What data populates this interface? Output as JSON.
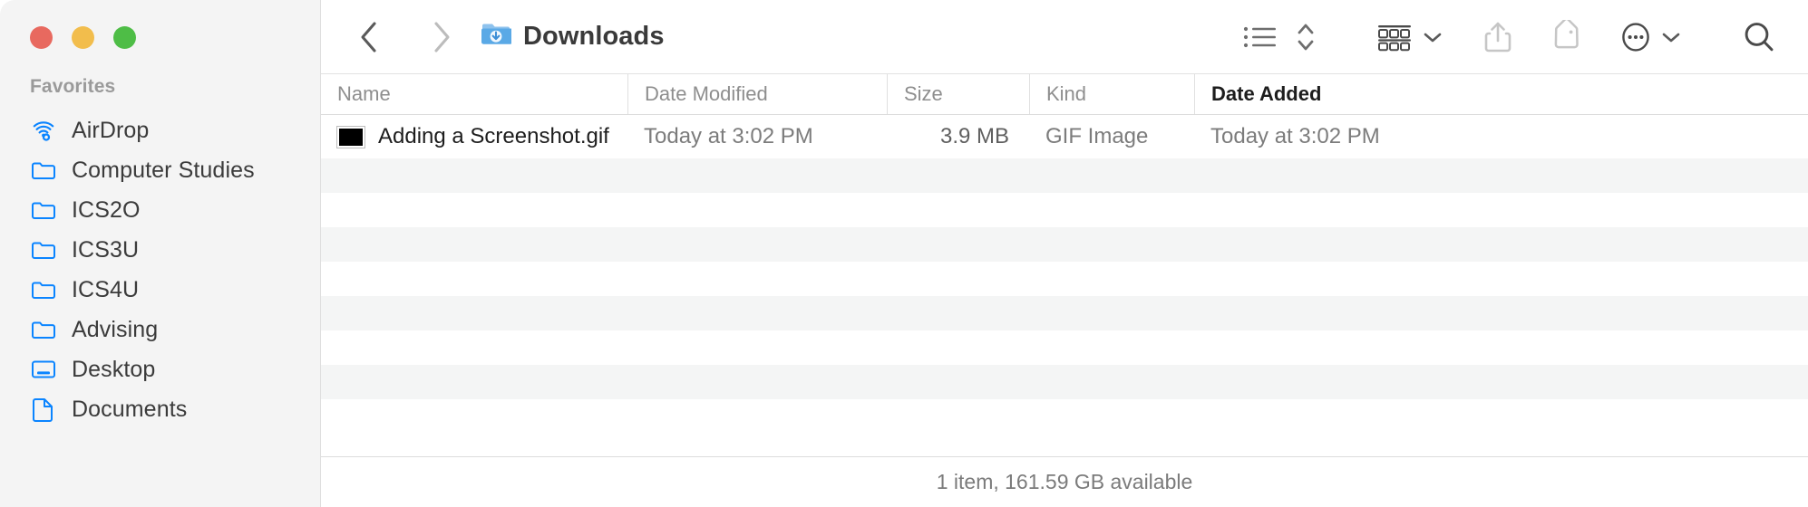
{
  "window": {
    "title": "Downloads",
    "title_icon": "downloads-folder-icon",
    "traffic_lights": [
      {
        "name": "close",
        "color": "#e8695f"
      },
      {
        "name": "minimize",
        "color": "#f2bd4c"
      },
      {
        "name": "zoom",
        "color": "#4ebd46"
      }
    ]
  },
  "sidebar": {
    "section_label": "Favorites",
    "items": [
      {
        "label": "AirDrop",
        "icon": "airdrop-icon"
      },
      {
        "label": "Computer Studies",
        "icon": "folder-icon"
      },
      {
        "label": "ICS2O",
        "icon": "folder-icon"
      },
      {
        "label": "ICS3U",
        "icon": "folder-icon"
      },
      {
        "label": "ICS4U",
        "icon": "folder-icon"
      },
      {
        "label": "Advising",
        "icon": "folder-icon"
      },
      {
        "label": "Desktop",
        "icon": "desktop-icon"
      },
      {
        "label": "Documents",
        "icon": "documents-icon"
      }
    ]
  },
  "toolbar": {
    "back_label": "Back",
    "forward_label": "Forward",
    "view_list_label": "List View",
    "view_stepper_label": "View Options",
    "group_label": "Group Items",
    "share_label": "Share",
    "tag_label": "Tags",
    "more_label": "More Options",
    "search_label": "Search"
  },
  "file_list": {
    "columns": [
      {
        "key": "name",
        "label": "Name",
        "active": false
      },
      {
        "key": "date_modified",
        "label": "Date Modified",
        "active": false
      },
      {
        "key": "size",
        "label": "Size",
        "active": false
      },
      {
        "key": "kind",
        "label": "Kind",
        "active": false
      },
      {
        "key": "date_added",
        "label": "Date Added",
        "active": true
      }
    ],
    "rows": [
      {
        "name": "Adding a Screenshot.gif",
        "date_modified": "Today at 3:02 PM",
        "size": "3.9 MB",
        "kind": "GIF Image",
        "date_added": "Today at 3:02 PM",
        "icon": "gif-thumbnail-icon"
      }
    ]
  },
  "status_bar": {
    "text": "1 item, 161.59 GB available"
  },
  "colors": {
    "accent_blue": "#0a84ff",
    "sidebar_bg": "#f4f4f4",
    "row_alt": "#f4f5f5",
    "active_column_text": "#1d1d1d"
  }
}
